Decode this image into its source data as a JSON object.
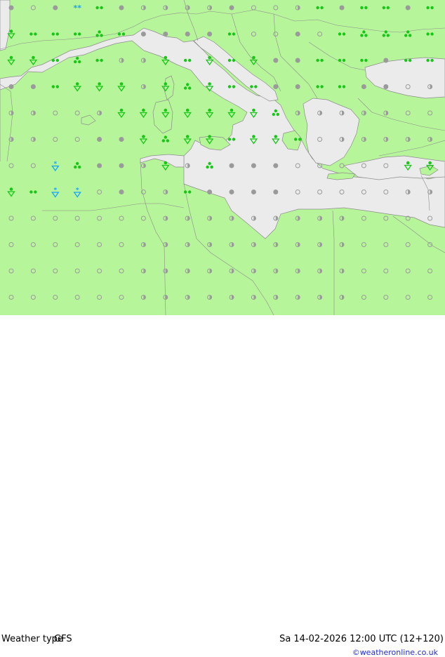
{
  "footer": {
    "title": "Weather type",
    "model": "GFS",
    "valid_time": "Sa 14-02-2026 12:00 UTC (12+120)",
    "credit": "©weatheronline.co.uk"
  },
  "colors": {
    "land": "#b7f59a",
    "sea": "#ebebeb",
    "border": "#8c8c8c",
    "rain_symbol": "#16c716",
    "cloud_symbol": "#9a9a9a",
    "snow_symbol": "#16a3ff",
    "credit_text": "#1f2bd6"
  },
  "legend_symbols": {
    "o": "clear",
    "h": "partly-cloudy",
    "c": "cloudy",
    "d": "drizzle",
    "t": "light-rain-shower",
    "r": "rain-shower",
    "s": "snow",
    "x": "snow-shower"
  },
  "grid": {
    "columns": 20,
    "rows": 12,
    "rows_data": [
      "cocsdchhhhcoohdcddcd",
      "rdddtdccccdoocodtttd",
      "rrdtdhhrdrdrccdddcdd",
      "ccdrrrhrtrddccddccoh",
      "hhoohrrrrrrrthhhhhoo",
      "hhooccrtrrdrrdohhhhh",
      "ooxtcchrhtcccooooork",
      "rdxxocohdccccooooohh",
      "ooooooohhhhhhhhhoooo",
      "oooooohhhhhhhhhhoooo",
      "oooooohhhhhhhhhhoooo",
      "oooooohhhhhhhhhhoooo"
    ]
  }
}
